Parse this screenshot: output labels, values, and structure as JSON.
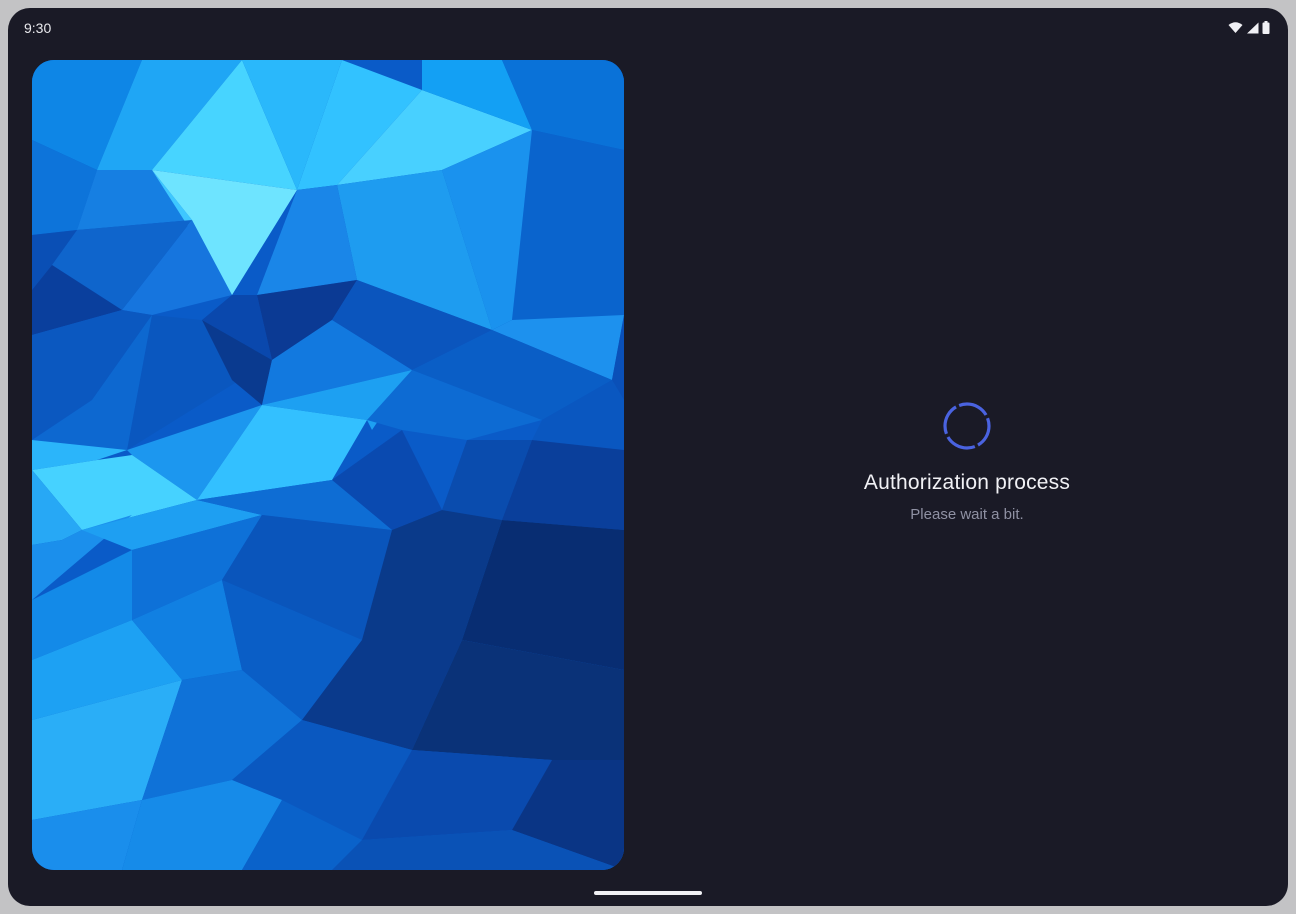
{
  "status_bar": {
    "time": "9:30",
    "icons": [
      "wifi-icon",
      "cellular-signal-icon",
      "battery-icon"
    ]
  },
  "wallpaper": {
    "description_icon": "polygon-wallpaper",
    "colors": [
      "#0a2f7a",
      "#0a5bc8",
      "#1d8ef0",
      "#3fc6ff",
      "#7ee6ff"
    ]
  },
  "auth": {
    "spinner_icon": "loading-spinner-icon",
    "spinner_color": "#4a63e0",
    "title": "Authorization process",
    "subtitle": "Please wait a bit."
  },
  "theme": {
    "background": "#1a1a26",
    "frame": "#c3c3c5"
  }
}
